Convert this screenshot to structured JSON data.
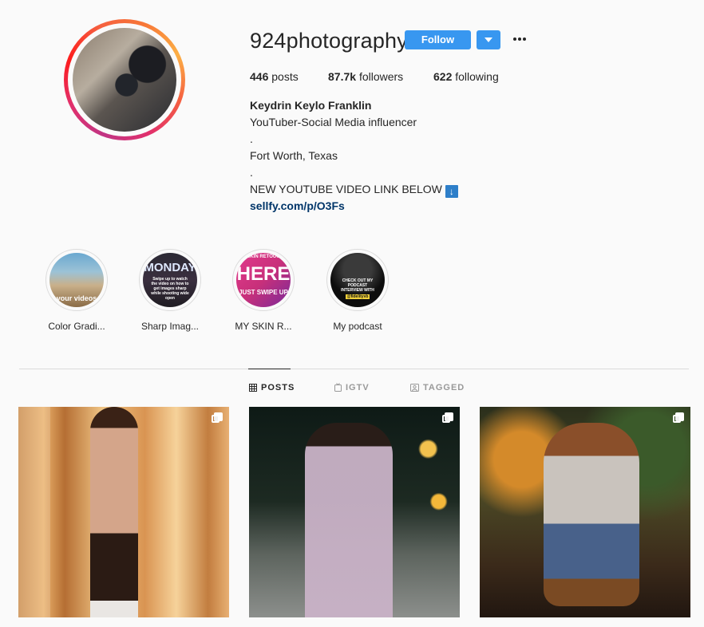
{
  "profile": {
    "username": "924photography",
    "follow_label": "Follow",
    "stats": [
      {
        "count": "446",
        "label": "posts"
      },
      {
        "count": "87.7k",
        "label": "followers"
      },
      {
        "count": "622",
        "label": "following"
      }
    ],
    "bio": {
      "full_name": "Keydrin Keylo Franklin",
      "lines": [
        "YouTuber-Social Media influencer",
        ".",
        "Fort Worth, Texas",
        ".",
        "NEW YOUTUBE VIDEO LINK BELOW"
      ],
      "link": "sellfy.com/p/O3Fs"
    }
  },
  "highlights": [
    {
      "label": "Color Gradi...",
      "overlay": "your videos"
    },
    {
      "label": "Sharp Imag...",
      "overlay_title": "MONDAY",
      "overlay_body": "Swipe up to watch the video on how to get images sharp while shooting wide open"
    },
    {
      "label": "MY SKIN R...",
      "overlay_top": "SKIN RETOUC",
      "overlay_title": "HERE",
      "overlay_body": "JUST SWIPE UP"
    },
    {
      "label": "My podcast",
      "overlay_body": "CHECK OUT MY PODCAST INTERVIEW WITH",
      "overlay_tag": "@fidelityvb"
    }
  ],
  "tabs": [
    {
      "label": "POSTS",
      "icon": "grid-icon",
      "active": true
    },
    {
      "label": "IGTV",
      "icon": "igtv-icon",
      "active": false
    },
    {
      "label": "TAGGED",
      "icon": "tagged-icon",
      "active": false
    }
  ],
  "posts": [
    {
      "icon": "multiple-images-icon"
    },
    {
      "icon": "multiple-images-icon"
    },
    {
      "icon": "multiple-images-icon"
    }
  ]
}
